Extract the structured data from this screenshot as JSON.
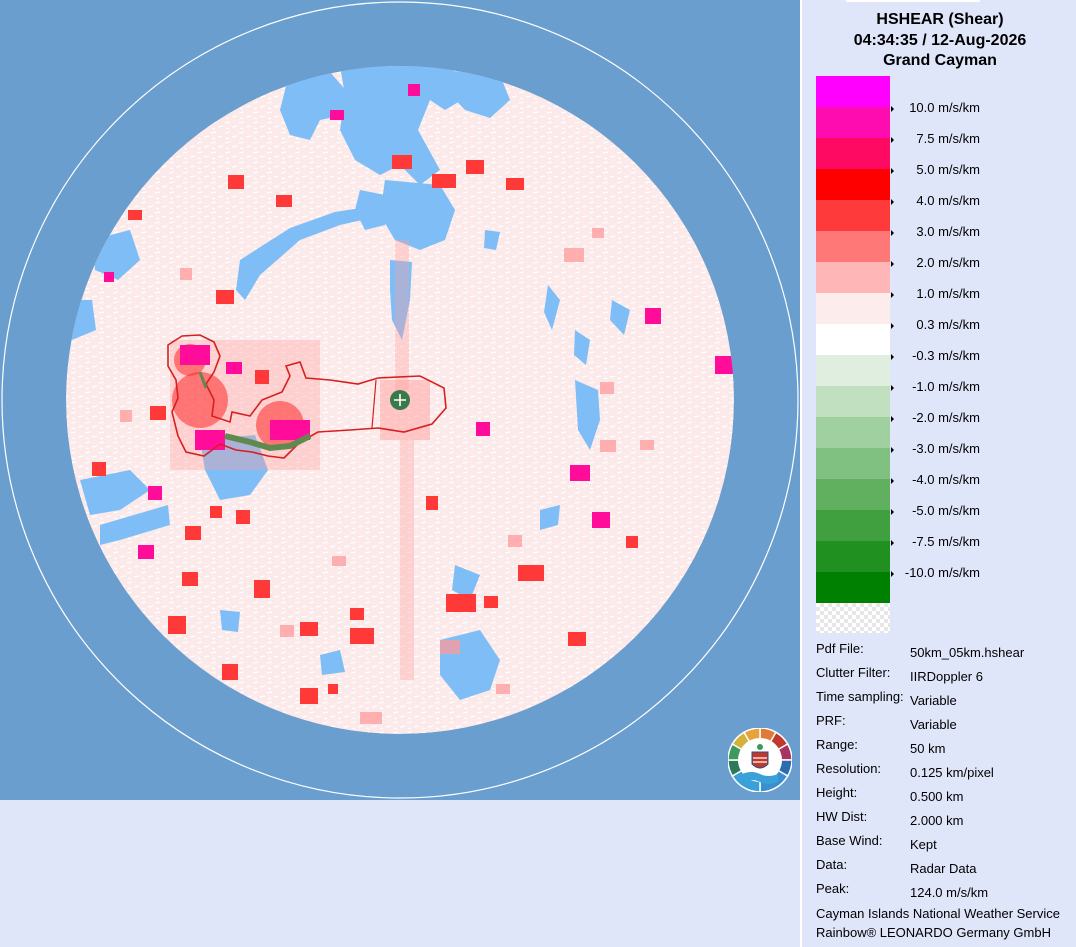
{
  "header": {
    "product": "HSHEAR (Shear)",
    "datetime": "04:34:35 / 12-Aug-2026",
    "site": "Grand Cayman"
  },
  "legend": [
    {
      "label": "",
      "color": "#ff00ff"
    },
    {
      "label": "10.0 m/s/km",
      "color": "#ff0cb0"
    },
    {
      "label": "7.5 m/s/km",
      "color": "#ff0a63"
    },
    {
      "label": "5.0 m/s/km",
      "color": "#ff0000"
    },
    {
      "label": "4.0 m/s/km",
      "color": "#ff3a3a"
    },
    {
      "label": "3.0 m/s/km",
      "color": "#ff7878"
    },
    {
      "label": "2.0 m/s/km",
      "color": "#ffb6b6"
    },
    {
      "label": "1.0 m/s/km",
      "color": "#fcecec"
    },
    {
      "label": "0.3 m/s/km",
      "color": "#ffffff"
    },
    {
      "label": "-0.3 m/s/km",
      "color": "#e0eee0"
    },
    {
      "label": "-1.0 m/s/km",
      "color": "#c0e0c0"
    },
    {
      "label": "-2.0 m/s/km",
      "color": "#a0d0a0"
    },
    {
      "label": "-3.0 m/s/km",
      "color": "#80c080"
    },
    {
      "label": "-4.0 m/s/km",
      "color": "#60b060"
    },
    {
      "label": "-5.0 m/s/km",
      "color": "#40a040"
    },
    {
      "label": "-7.5 m/s/km",
      "color": "#209020"
    },
    {
      "label": "-10.0 m/s/km",
      "color": "#008000"
    }
  ],
  "legend_nodata": "checker",
  "info": [
    {
      "key": "Pdf File:",
      "value": "50km_05km.hshear"
    },
    {
      "key": "Clutter Filter:",
      "value": "IIRDoppler 6"
    },
    {
      "key": "Time sampling:",
      "value": "Variable"
    },
    {
      "key": "PRF:",
      "value": "Variable"
    },
    {
      "key": "Range:",
      "value": "50 km"
    },
    {
      "key": "Resolution:",
      "value": "0.125 km/pixel"
    },
    {
      "key": "Height:",
      "value": "0.500 km"
    },
    {
      "key": "HW Dist:",
      "value": "2.000 km"
    },
    {
      "key": "Base Wind:",
      "value": "Kept"
    },
    {
      "key": "Data:",
      "value": "Radar Data"
    },
    {
      "key": "Peak:",
      "value": "124.0 m/s/km"
    }
  ],
  "credits": {
    "line1": "Cayman Islands National Weather Service",
    "line2": "Rainbow® LEONARDO Germany GmbH"
  },
  "map": {
    "background_color": "#6a9ece",
    "ocean_echo_color": "#fceaea",
    "clear_color": "#7fbdf7",
    "island_outline_color": "#d62020",
    "radar_marker_color": "#3a7a4a",
    "logo": "cayman-islands-national-weather-service-emblem"
  }
}
